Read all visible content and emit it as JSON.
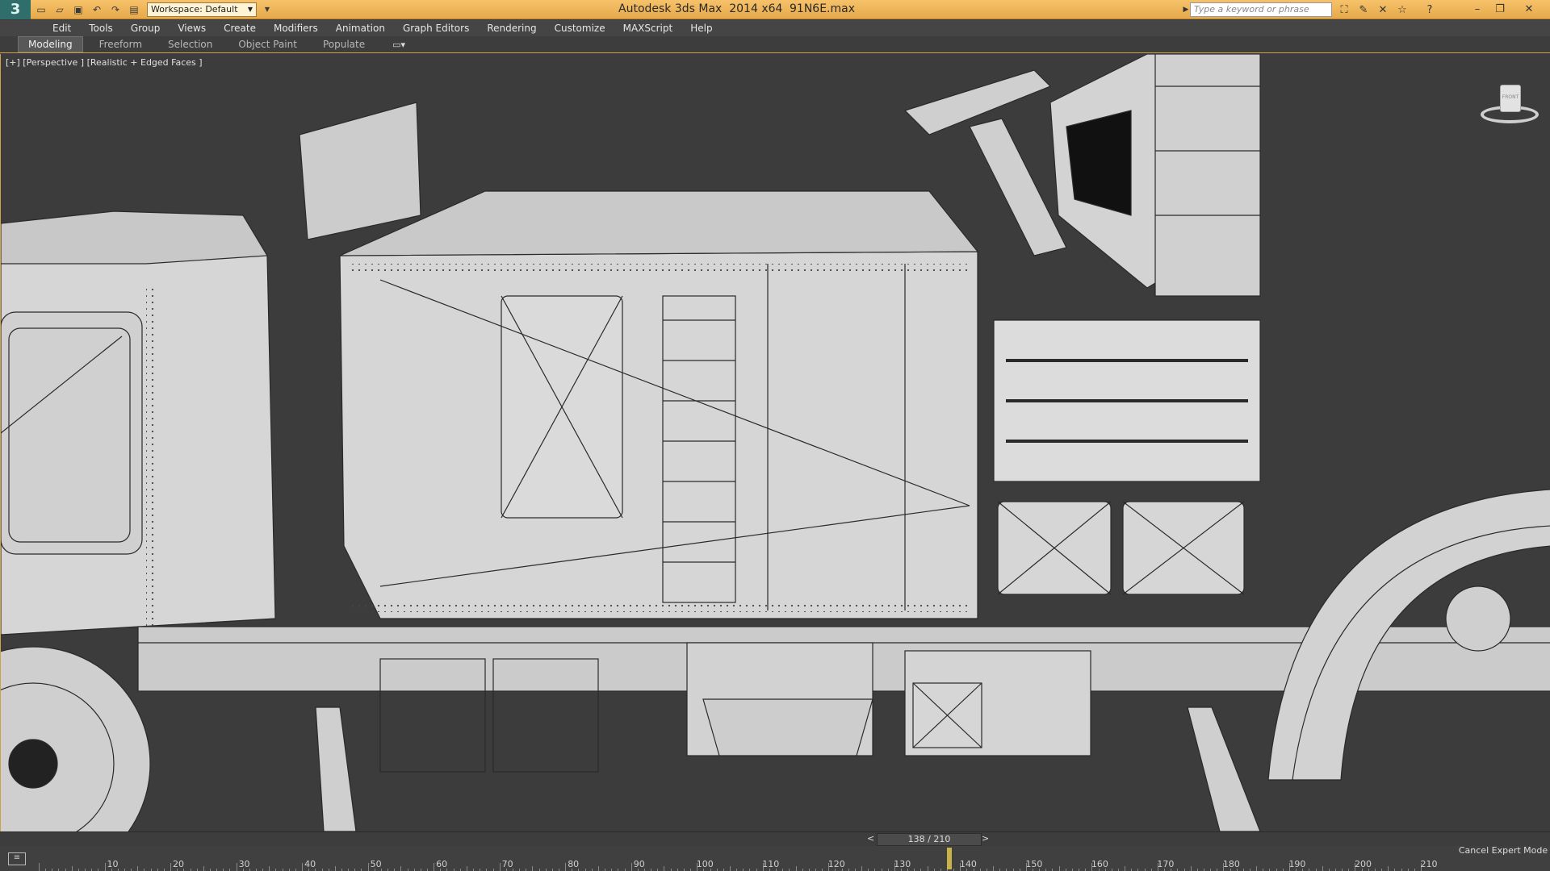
{
  "window": {
    "app_title": "Autodesk 3ds Max  2014 x64",
    "file_name": "91N6E.max",
    "workspace_label": "Workspace: Default",
    "search_placeholder": "Type a keyword or phrase",
    "logo_text": "3"
  },
  "menu": [
    "Edit",
    "Tools",
    "Group",
    "Views",
    "Create",
    "Modifiers",
    "Animation",
    "Graph Editors",
    "Rendering",
    "Customize",
    "MAXScript",
    "Help"
  ],
  "ribbon_tabs": [
    "Modeling",
    "Freeform",
    "Selection",
    "Object Paint",
    "Populate"
  ],
  "viewport": {
    "label": "[+] [Perspective ] [Realistic + Edged Faces ]",
    "viewcube_face": "FRONT"
  },
  "timeline": {
    "frame_display": "138 / 210",
    "current_frame": 138,
    "total_frames": 210,
    "ruler_labels": [
      10,
      20,
      30,
      40,
      50,
      60,
      70,
      80,
      90,
      100,
      110,
      120,
      130,
      140,
      150,
      160,
      170,
      180,
      190,
      200,
      210
    ],
    "prev_label": "<",
    "next_label": ">"
  },
  "status": {
    "expert_mode": "Cancel Expert Mode"
  },
  "colors": {
    "titlebar": "#e7a94a",
    "accent": "#d2a048",
    "viewport_bg": "#3c3c3c",
    "model_fill": "#d4d4d4",
    "marker": "#c8b24a"
  }
}
